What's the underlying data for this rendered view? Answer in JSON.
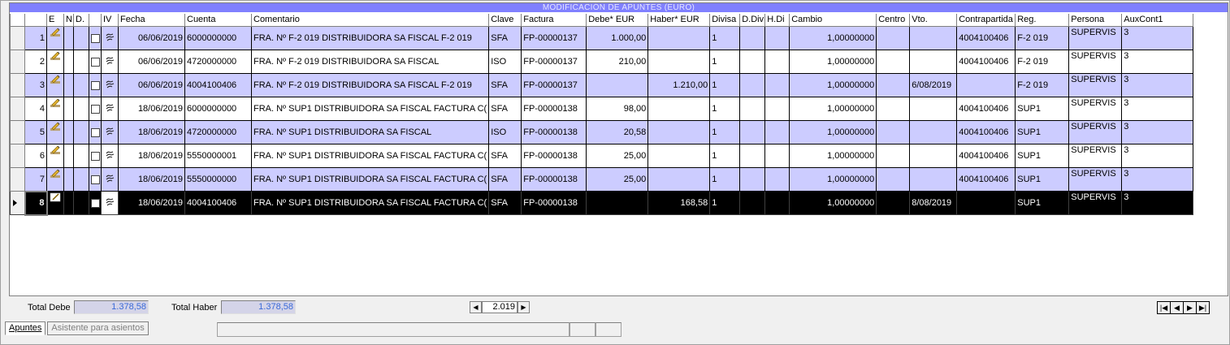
{
  "grid": {
    "title": "MODIFICACIÓN DE APUNTES (EURO)",
    "columns": [
      "",
      "",
      "E",
      "N",
      "D.",
      "",
      "IV",
      "Fecha",
      "Cuenta",
      "Comentario",
      "Clave",
      "Factura",
      "Debe* EUR",
      "Haber* EUR",
      "Divisa",
      "D.Div",
      "H.Di",
      "Cambio",
      "Centro",
      "Vto.",
      "Contrapartida",
      "Reg.",
      "Persona",
      "AuxCont1"
    ],
    "rows": [
      {
        "n": "1",
        "fecha": "06/06/2019",
        "cuenta": "6000000000",
        "comentario": "FRA. Nº F-2 019 DISTRIBUIDORA  SA FISCAL F-2 019",
        "clave": "SFA",
        "factura": "FP-00000137",
        "debe": "1.000,00",
        "haber": "",
        "divisa": "1",
        "ddiv": "",
        "hdi": "",
        "cambio": "1,00000000",
        "centro": "",
        "vto": "",
        "contra": "4004100406",
        "reg": "F-2 019",
        "persona": "SUPERVIS",
        "aux": "3"
      },
      {
        "n": "2",
        "fecha": "06/06/2019",
        "cuenta": "4720000000",
        "comentario": "FRA. Nº F-2 019 DISTRIBUIDORA  SA FISCAL",
        "clave": "ISO",
        "factura": "FP-00000137",
        "debe": "210,00",
        "haber": "",
        "divisa": "1",
        "ddiv": "",
        "hdi": "",
        "cambio": "1,00000000",
        "centro": "",
        "vto": "",
        "contra": "4004100406",
        "reg": "F-2 019",
        "persona": "SUPERVIS",
        "aux": "3"
      },
      {
        "n": "3",
        "fecha": "06/06/2019",
        "cuenta": "4004100406",
        "comentario": "FRA. Nº F-2 019 DISTRIBUIDORA  SA FISCAL F-2 019",
        "clave": "SFA",
        "factura": "FP-00000137",
        "debe": "",
        "haber": "1.210,00",
        "divisa": "1",
        "ddiv": "",
        "hdi": "",
        "cambio": "1,00000000",
        "centro": "",
        "vto": "6/08/2019",
        "contra": "",
        "reg": "F-2 019",
        "persona": "SUPERVIS",
        "aux": "3"
      },
      {
        "n": "4",
        "fecha": "18/06/2019",
        "cuenta": "6000000000",
        "comentario": "FRA. Nº SUP1 DISTRIBUIDORA  SA FISCAL FACTURA C(",
        "clave": "SFA",
        "factura": "FP-00000138",
        "debe": "98,00",
        "haber": "",
        "divisa": "1",
        "ddiv": "",
        "hdi": "",
        "cambio": "1,00000000",
        "centro": "",
        "vto": "",
        "contra": "4004100406",
        "reg": "SUP1",
        "persona": "SUPERVIS",
        "aux": "3"
      },
      {
        "n": "5",
        "fecha": "18/06/2019",
        "cuenta": "4720000000",
        "comentario": "FRA. Nº SUP1 DISTRIBUIDORA  SA FISCAL",
        "clave": "ISO",
        "factura": "FP-00000138",
        "debe": "20,58",
        "haber": "",
        "divisa": "1",
        "ddiv": "",
        "hdi": "",
        "cambio": "1,00000000",
        "centro": "",
        "vto": "",
        "contra": "4004100406",
        "reg": "SUP1",
        "persona": "SUPERVIS",
        "aux": "3"
      },
      {
        "n": "6",
        "fecha": "18/06/2019",
        "cuenta": "5550000001",
        "comentario": "FRA. Nº SUP1 DISTRIBUIDORA  SA FISCAL FACTURA C(",
        "clave": "SFA",
        "factura": "FP-00000138",
        "debe": "25,00",
        "haber": "",
        "divisa": "1",
        "ddiv": "",
        "hdi": "",
        "cambio": "1,00000000",
        "centro": "",
        "vto": "",
        "contra": "4004100406",
        "reg": "SUP1",
        "persona": "SUPERVIS",
        "aux": "3"
      },
      {
        "n": "7",
        "fecha": "18/06/2019",
        "cuenta": "5550000000",
        "comentario": "FRA. Nº SUP1 DISTRIBUIDORA  SA FISCAL FACTURA C(",
        "clave": "SFA",
        "factura": "FP-00000138",
        "debe": "25,00",
        "haber": "",
        "divisa": "1",
        "ddiv": "",
        "hdi": "",
        "cambio": "1,00000000",
        "centro": "",
        "vto": "",
        "contra": "4004100406",
        "reg": "SUP1",
        "persona": "SUPERVIS",
        "aux": "3"
      },
      {
        "n": "8",
        "fecha": "18/06/2019",
        "cuenta": "4004100406",
        "comentario": "FRA. Nº SUP1 DISTRIBUIDORA  SA FISCAL FACTURA C(",
        "clave": "SFA",
        "factura": "FP-00000138",
        "debe": "",
        "haber": "168,58",
        "divisa": "1",
        "ddiv": "",
        "hdi": "",
        "cambio": "1,00000000",
        "centro": "",
        "vto": "8/08/2019",
        "contra": "",
        "reg": "SUP1",
        "persona": "SUPERVIS",
        "aux": "3"
      }
    ],
    "selected_row": 8
  },
  "totals": {
    "debe_label": "Total Debe",
    "debe_value": "1.378,58",
    "haber_label": "Total Haber",
    "haber_value": "1.378,58"
  },
  "year": {
    "value": "2.019"
  },
  "tabs": [
    {
      "label": "Apuntes",
      "active": true
    },
    {
      "label": "Asistente para asientos",
      "active": false
    }
  ],
  "colors": {
    "title_bar": "#8080ff",
    "row_alt": "#ccccff",
    "selected": "#000000",
    "totals_text": "#3a6ad8"
  },
  "icons": {
    "edit": "pencil-icon",
    "iv": "link-icon",
    "check": "checkbox-icon",
    "row_marker": "row-pointer-icon"
  }
}
